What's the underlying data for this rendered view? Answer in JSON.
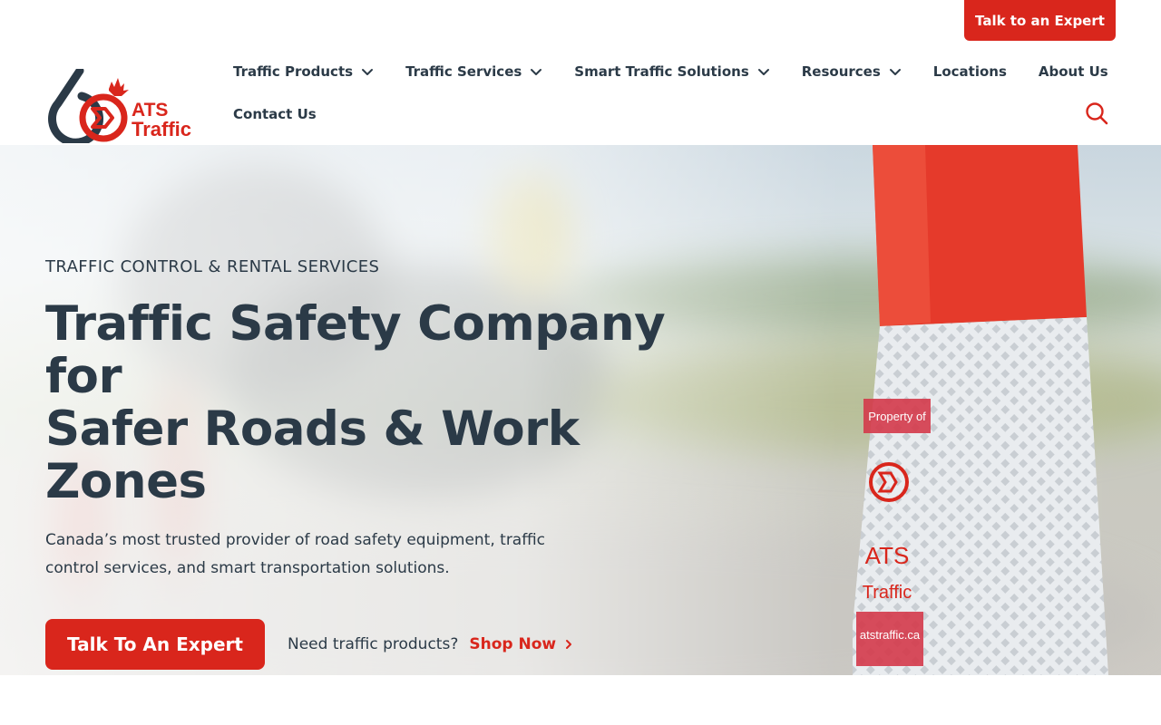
{
  "header": {
    "top_cta_label": "Talk to an Expert",
    "logo": {
      "badge_number": "60",
      "brand_line1": "ATS",
      "brand_line2": "Traffic"
    },
    "nav_items": [
      {
        "label": "Traffic Products",
        "has_dropdown": true
      },
      {
        "label": "Traffic Services",
        "has_dropdown": true
      },
      {
        "label": "Smart Traffic Solutions",
        "has_dropdown": true
      },
      {
        "label": "Resources",
        "has_dropdown": true
      },
      {
        "label": "Locations",
        "has_dropdown": false
      },
      {
        "label": "About Us",
        "has_dropdown": false
      },
      {
        "label": "Contact Us",
        "has_dropdown": false
      }
    ],
    "search_icon": "search-icon"
  },
  "hero": {
    "eyebrow": "TRAFFIC CONTROL & RENTAL SERVICES",
    "title_line1": "Traffic Safety Company for",
    "title_line2": "Safer Roads & Work Zones",
    "subtitle": "Canada’s most trusted provider of road safety equipment, traffic control services, and smart transportation solutions.",
    "primary_button": "Talk To An Expert",
    "secondary_prompt": "Need traffic products?",
    "shop_link": "Shop Now",
    "cone_label": {
      "line1": "Property of",
      "line2": "ATS",
      "line3": "Traffic",
      "line4": "atstraffic.ca"
    }
  },
  "colors": {
    "brand_red": "#d9261c",
    "text_dark": "#2b3a47",
    "background": "#ffffff"
  }
}
